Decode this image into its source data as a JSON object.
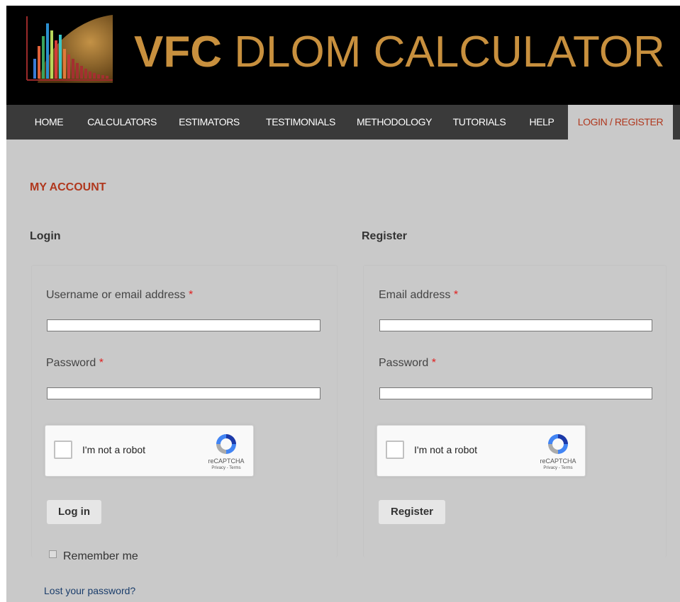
{
  "brand": {
    "bold": "VFC",
    "rest": " DLOM CALCULATOR"
  },
  "nav": {
    "items": [
      "HOME",
      "CALCULATORS",
      "ESTIMATORS",
      "TESTIMONIALS",
      "METHODOLOGY",
      "TUTORIALS",
      "HELP",
      "LOGIN / REGISTER"
    ],
    "active": "LOGIN / REGISTER"
  },
  "page_title": "MY ACCOUNT",
  "login": {
    "heading": "Login",
    "username_label": "Username or email address",
    "username_value": "",
    "password_label": "Password",
    "password_value": "",
    "required_mark": "*",
    "captcha": {
      "text": "I'm not a robot",
      "brand": "reCAPTCHA",
      "links": "Privacy - Terms"
    },
    "button": "Log in",
    "remember_label": "Remember me",
    "lost_password": "Lost your password?"
  },
  "register": {
    "heading": "Register",
    "email_label": "Email address",
    "email_value": "",
    "password_label": "Password",
    "password_value": "",
    "required_mark": "*",
    "captcha": {
      "text": "I'm not a robot",
      "brand": "reCAPTCHA",
      "links": "Privacy - Terms"
    },
    "button": "Register"
  },
  "colors": {
    "brand_gold": "#c8903e",
    "accent_red": "#b0381e",
    "nav_bg": "#3a3a3a",
    "page_bg": "#c9c9c9"
  }
}
